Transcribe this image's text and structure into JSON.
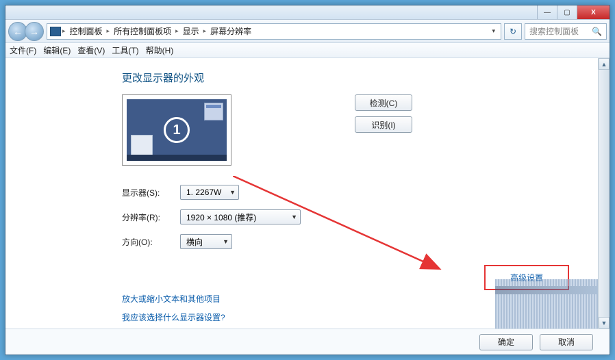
{
  "titlebar": {
    "min": "—",
    "max": "▢",
    "close": "X"
  },
  "nav": {
    "back": "←",
    "fwd": "→",
    "refresh": "↻"
  },
  "breadcrumbs": [
    "控制面板",
    "所有控制面板项",
    "显示",
    "屏幕分辨率"
  ],
  "search": {
    "placeholder": "搜索控制面板"
  },
  "menu": {
    "file": "文件(F)",
    "edit": "编辑(E)",
    "view": "查看(V)",
    "tools": "工具(T)",
    "help": "帮助(H)"
  },
  "page": {
    "heading": "更改显示器的外观",
    "monitor_number": "1",
    "detect": "检测(C)",
    "identify": "识别(I)",
    "display_label": "显示器(S):",
    "display_value": "1. 2267W",
    "resolution_label": "分辨率(R):",
    "resolution_value": "1920 × 1080 (推荐)",
    "orientation_label": "方向(O):",
    "orientation_value": "横向",
    "advanced": "高级设置",
    "link1": "放大或缩小文本和其他项目",
    "link2": "我应该选择什么显示器设置?",
    "ok": "确定",
    "cancel": "取消"
  }
}
